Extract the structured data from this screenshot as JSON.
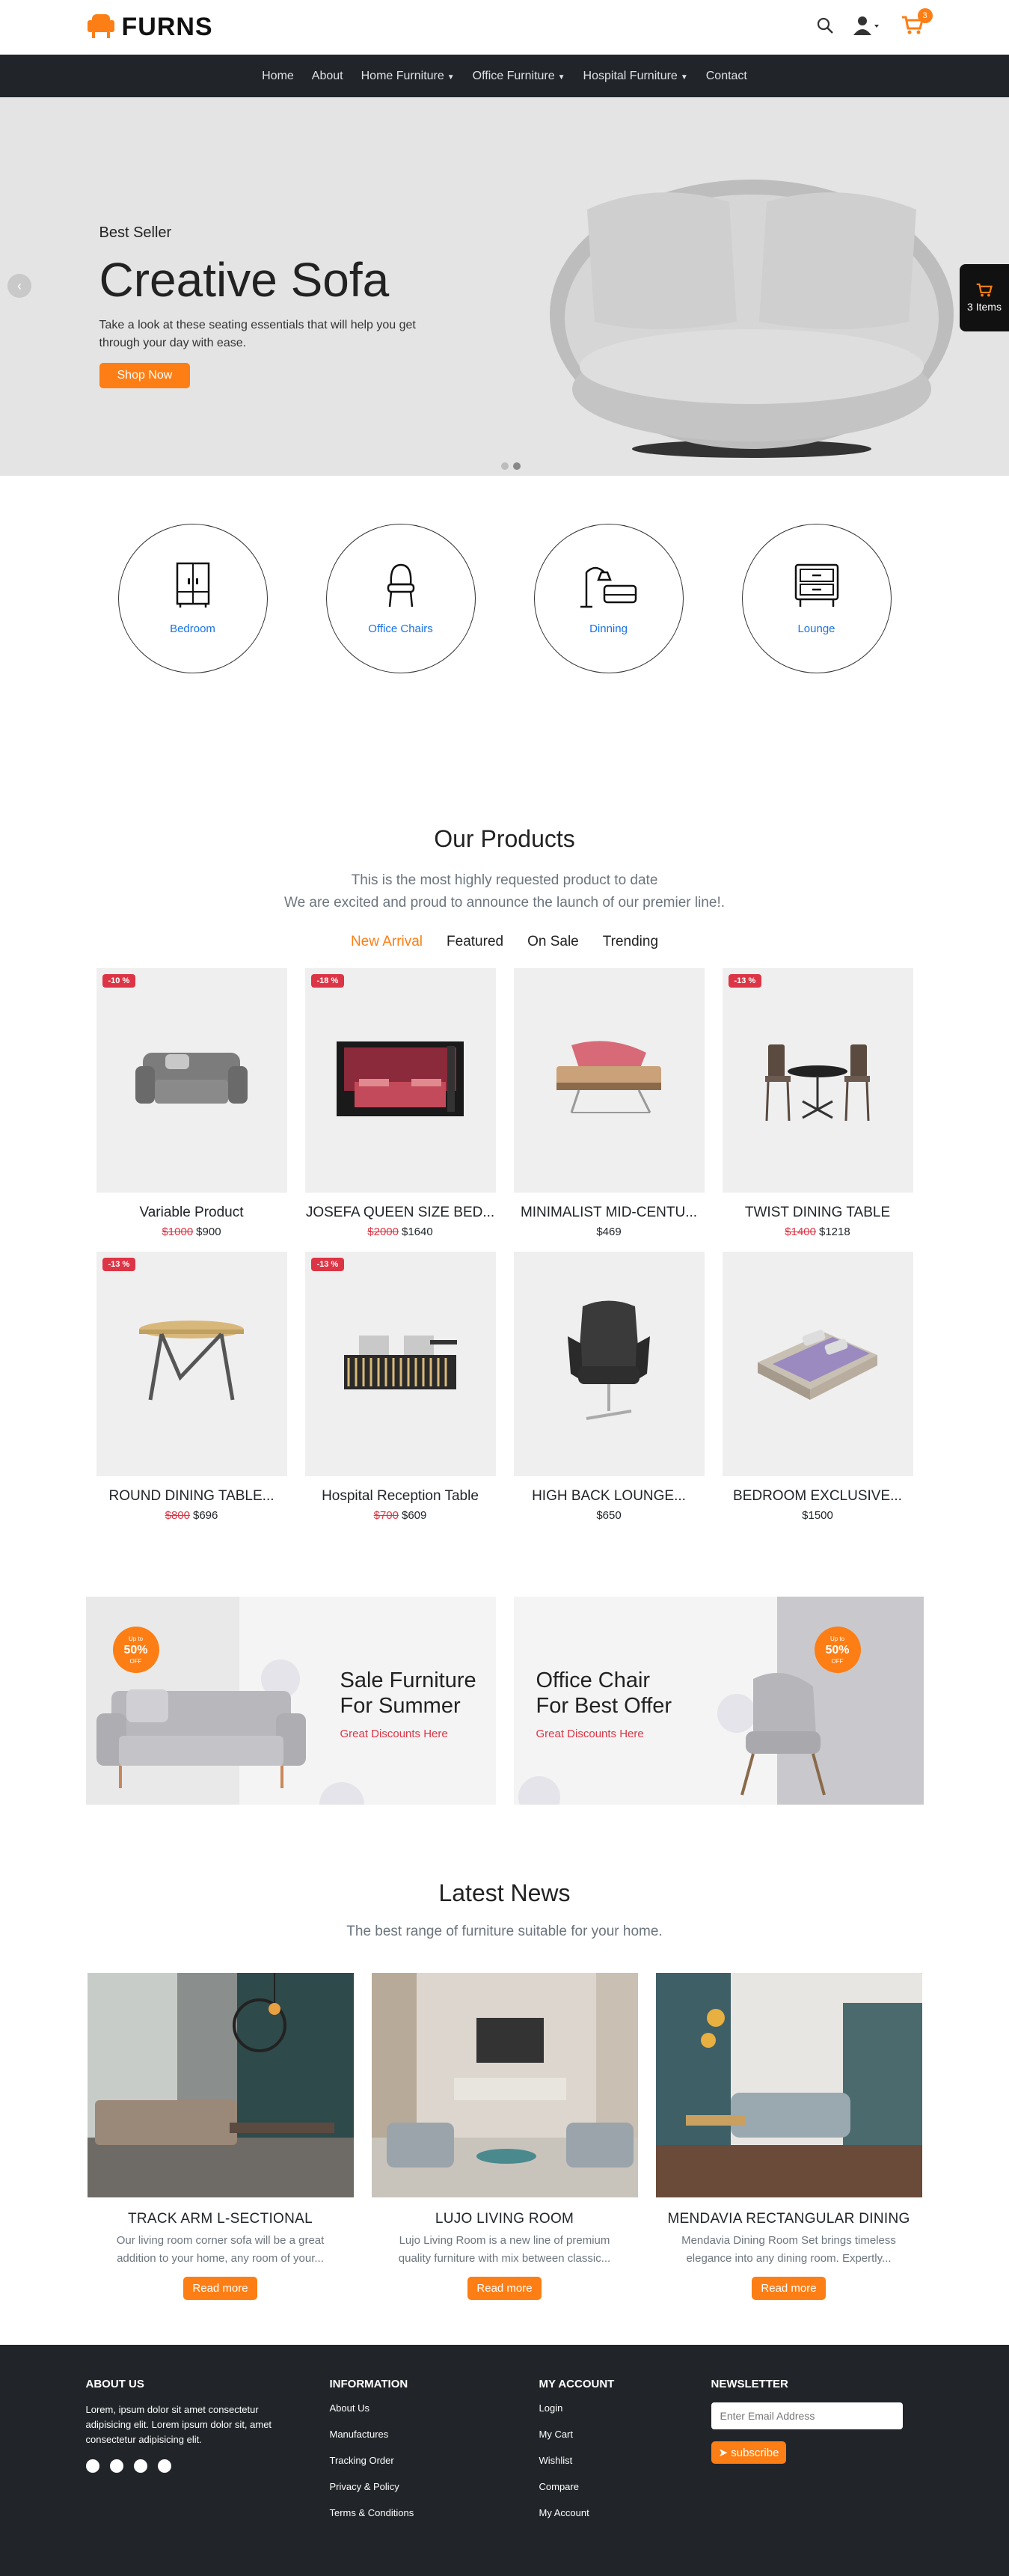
{
  "brand": {
    "name": "FURNS",
    "accent": "#fd7e14"
  },
  "header": {
    "cart_count": "3"
  },
  "nav": [
    {
      "label": "Home",
      "dropdown": false
    },
    {
      "label": "About",
      "dropdown": false
    },
    {
      "label": "Home Furniture",
      "dropdown": true
    },
    {
      "label": "Office Furniture",
      "dropdown": true
    },
    {
      "label": "Hospital Furniture",
      "dropdown": true
    },
    {
      "label": "Contact",
      "dropdown": false
    }
  ],
  "hero": {
    "subtitle": "Best Seller",
    "title": "Creative Sofa",
    "description": "Take a look at these seating essentials that will help you get through your day with ease.",
    "button": "Shop Now",
    "slides": 2,
    "active_slide": 2
  },
  "floating_cart": {
    "label": "3 Items"
  },
  "categories": [
    {
      "label": "Bedroom",
      "icon": "wardrobe-icon"
    },
    {
      "label": "Office Chairs",
      "icon": "chair-icon"
    },
    {
      "label": "Dinning",
      "icon": "lamp-sofa-icon"
    },
    {
      "label": "Lounge",
      "icon": "nightstand-icon"
    }
  ],
  "products": {
    "title": "Our Products",
    "subtitle_1": "This is the most highly requested product to date",
    "subtitle_2": "We are excited and proud to announce the launch of our premier line!.",
    "tabs": [
      {
        "label": "New Arrival",
        "active": true
      },
      {
        "label": "Featured",
        "active": false
      },
      {
        "label": "On Sale",
        "active": false
      },
      {
        "label": "Trending",
        "active": false
      }
    ],
    "items": [
      {
        "name": "Variable Product",
        "discount": "-10 %",
        "old_price": "$1000",
        "price": "$900",
        "image": "armchair"
      },
      {
        "name": "JOSEFA QUEEN SIZE BED...",
        "discount": "-18 %",
        "old_price": "$2000",
        "price": "$1640",
        "image": "bed-red"
      },
      {
        "name": "MINIMALIST MID-CENTU...",
        "discount": "",
        "old_price": "",
        "price": "$469",
        "image": "bench"
      },
      {
        "name": "TWIST DINING TABLE",
        "discount": "-13 %",
        "old_price": "$1400",
        "price": "$1218",
        "image": "dining-set"
      },
      {
        "name": "ROUND DINING TABLE...",
        "discount": "-13 %",
        "old_price": "$800",
        "price": "$696",
        "image": "round-table"
      },
      {
        "name": "Hospital Reception Table",
        "discount": "-13 %",
        "old_price": "$700",
        "price": "$609",
        "image": "reception"
      },
      {
        "name": "HIGH BACK LOUNGE...",
        "discount": "",
        "old_price": "",
        "price": "$650",
        "image": "lounge-chair"
      },
      {
        "name": "BEDROOM EXCLUSIVE...",
        "discount": "",
        "old_price": "",
        "price": "$1500",
        "image": "bed-grey"
      }
    ]
  },
  "banners": [
    {
      "title_1": "Sale Furniture",
      "title_2": "For Summer",
      "link": "Great Discounts Here",
      "badge_top": "Up to",
      "badge_main": "50%",
      "badge_bottom": "OFF"
    },
    {
      "title_1": "Office Chair",
      "title_2": "For Best Offer",
      "link": "Great Discounts Here",
      "badge_top": "Up to",
      "badge_main": "50%",
      "badge_bottom": "OFF"
    }
  ],
  "news": {
    "title": "Latest News",
    "subtitle": "The best range of furniture suitable for your home.",
    "items": [
      {
        "title": "TRACK ARM L-SECTIONAL",
        "description": "Our living room corner sofa will be a great addition to your home, any room of your...",
        "button": "Read more"
      },
      {
        "title": "LUJO LIVING ROOM",
        "description": "Lujo Living Room is a new line of premium quality furniture with mix between classic...",
        "button": "Read more"
      },
      {
        "title": "MENDAVIA RECTANGULAR DINING",
        "description": "Mendavia Dining Room Set brings timeless elegance into any dining room. Expertly...",
        "button": "Read more"
      }
    ]
  },
  "footer": {
    "about_title": "ABOUT US",
    "about_text": "Lorem, ipsum dolor sit amet consectetur adipisicing elit. Lorem ipsum dolor sit, amet consectetur adipisicing elit.",
    "info_title": "INFORMATION",
    "info_links": [
      "About Us",
      "Manufactures",
      "Tracking Order",
      "Privacy & Policy",
      "Terms & Conditions"
    ],
    "account_title": "MY ACCOUNT",
    "account_links": [
      "Login",
      "My Cart",
      "Wishlist",
      "Compare",
      "My Account"
    ],
    "newsletter_title": "NEWSLETTER",
    "newsletter_placeholder": "Enter Email Address",
    "newsletter_button": "subscribe",
    "social": [
      "facebook-icon",
      "twitter-icon",
      "linkedin-icon",
      "youtube-icon"
    ]
  }
}
